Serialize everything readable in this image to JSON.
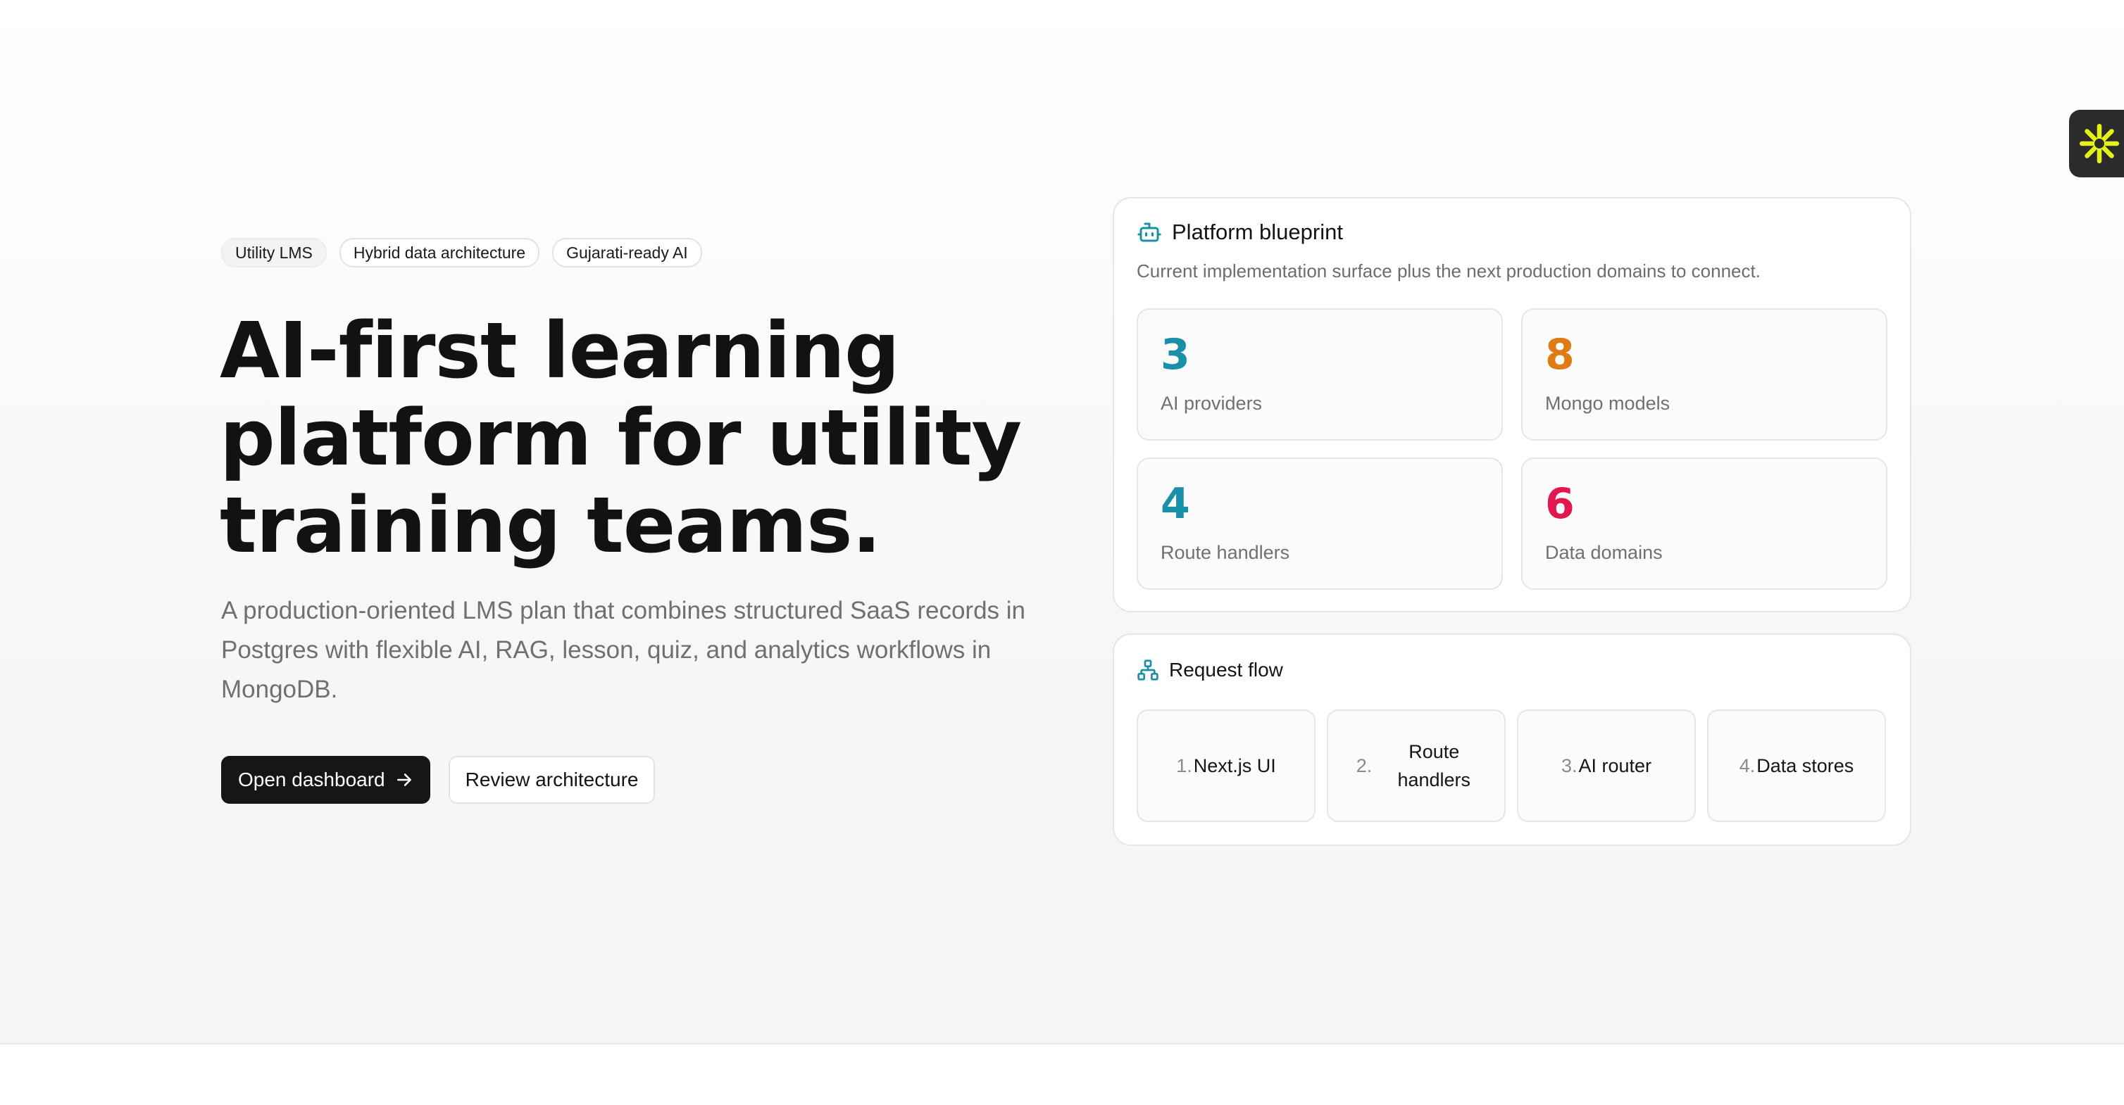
{
  "tags": [
    "Utility LMS",
    "Hybrid data architecture",
    "Gujarati-ready AI"
  ],
  "hero": {
    "headline_lines": [
      "AI-first learning",
      "platform for utility",
      "training teams."
    ],
    "description": "A production-oriented LMS plan that combines structured SaaS records in Postgres with flexible AI, RAG, lesson, quiz, and analytics workflows in MongoDB.",
    "primary_button": "Open dashboard",
    "secondary_button": "Review architecture"
  },
  "blueprint": {
    "title": "Platform blueprint",
    "subtitle": "Current implementation surface plus the next production domains to connect.",
    "stats": [
      {
        "value": "3",
        "label": "AI providers",
        "color": "#1a8fa8"
      },
      {
        "value": "8",
        "label": "Mongo models",
        "color": "#e07a12"
      },
      {
        "value": "4",
        "label": "Route handlers",
        "color": "#1a8fa8"
      },
      {
        "value": "6",
        "label": "Data domains",
        "color": "#e0184d"
      }
    ]
  },
  "flow": {
    "title": "Request flow",
    "steps": [
      {
        "num": "1.",
        "label": "Next.js UI"
      },
      {
        "num": "2.",
        "label": "Route handlers"
      },
      {
        "num": "3.",
        "label": "AI router"
      },
      {
        "num": "4.",
        "label": "Data stores"
      }
    ]
  },
  "colors": {
    "accent_teal": "#1a8fa8",
    "widget_yellow": "#e3f21a"
  }
}
